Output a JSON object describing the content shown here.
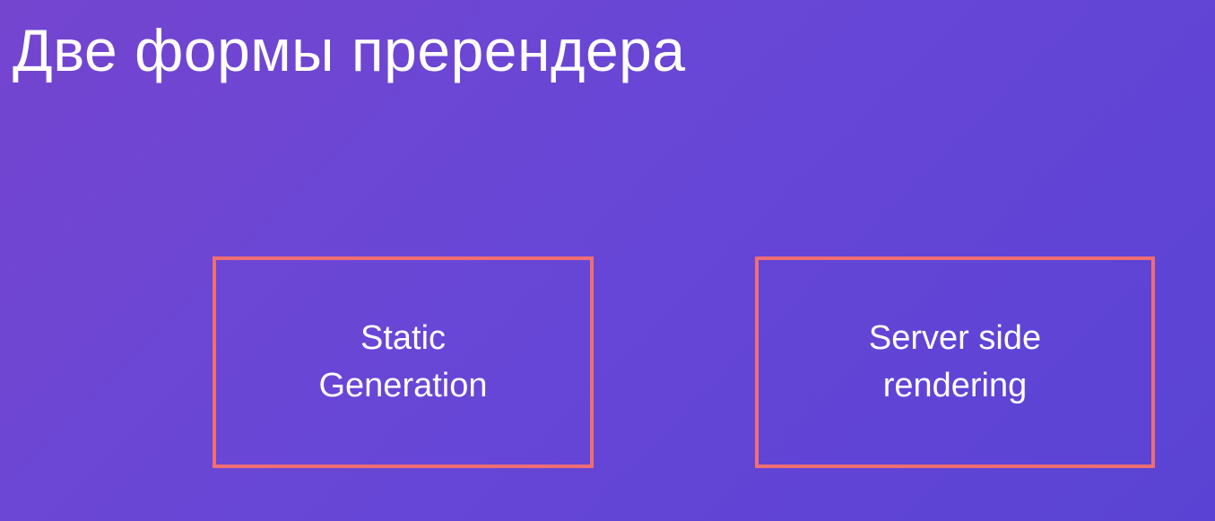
{
  "slide": {
    "title": "Две формы пререндера",
    "boxes": [
      {
        "lines": [
          "Static",
          "Generation"
        ]
      },
      {
        "lines": [
          "Server side",
          "rendering"
        ]
      }
    ],
    "colors": {
      "background_start": "#7445cf",
      "background_end": "#5a43d4",
      "box_border": "#ee6e73",
      "text": "#ffffff"
    }
  }
}
